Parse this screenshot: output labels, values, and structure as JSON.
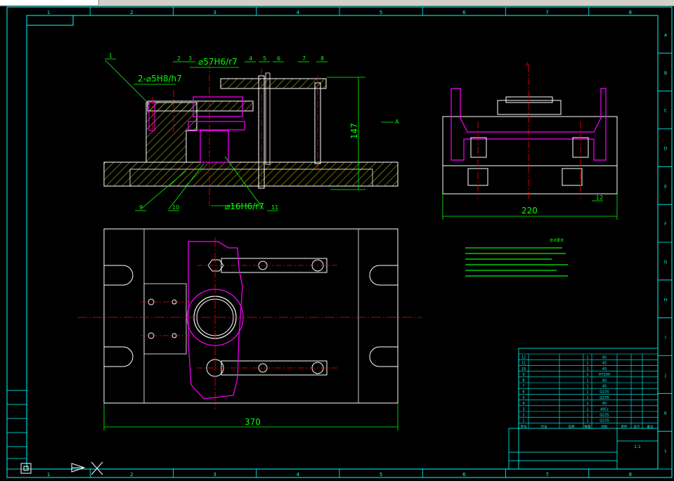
{
  "window": {
    "title": ""
  },
  "colors": {
    "background": "#000000",
    "frame": "#00ffff",
    "part": "#ffffff",
    "dimension": "#00ff00",
    "workpiece": "#ff00ff",
    "centerline": "#ff0000",
    "hatch": "#ffff00",
    "toolbar": "#d4d0c8"
  },
  "drawing": {
    "zone_columns": [
      "1",
      "2",
      "3",
      "4",
      "5",
      "6",
      "7",
      "8"
    ],
    "zone_rows": [
      "A",
      "B",
      "C",
      "D",
      "E",
      "F",
      "G",
      "H",
      "I",
      "J",
      "K",
      "L"
    ],
    "dimensions": {
      "fit_top": "⌀57H6/r7",
      "fit_pins": "2-⌀5H8/h7",
      "fit_bottom": "⌀16H6/r7",
      "height": "147",
      "width_side": "220",
      "width_plan": "370"
    },
    "view_arrows": {
      "section_a_top": "A",
      "view_a_side": "A"
    },
    "balloons": [
      "1",
      "2",
      "3",
      "4",
      "5",
      "6",
      "7",
      "8",
      "9",
      "10",
      "11",
      "12"
    ],
    "tech_notes_title": "技术要求"
  },
  "title_block": {
    "parts_rows": 12,
    "quantity_cells": [
      "1",
      "1",
      "1",
      "1",
      "1",
      "1",
      "1",
      "1",
      "1",
      "1",
      "1",
      "1"
    ],
    "material_cells": [
      "45",
      "45",
      "45",
      "HT200",
      "45",
      "45",
      "Q235",
      "Q235",
      "45",
      "40Cr",
      "Q235",
      "Q235"
    ],
    "scale_cell": "1:1",
    "header_cells": [
      "序号",
      "代号",
      "名称",
      "数量",
      "材料",
      "单件",
      "总计",
      "备注"
    ]
  }
}
